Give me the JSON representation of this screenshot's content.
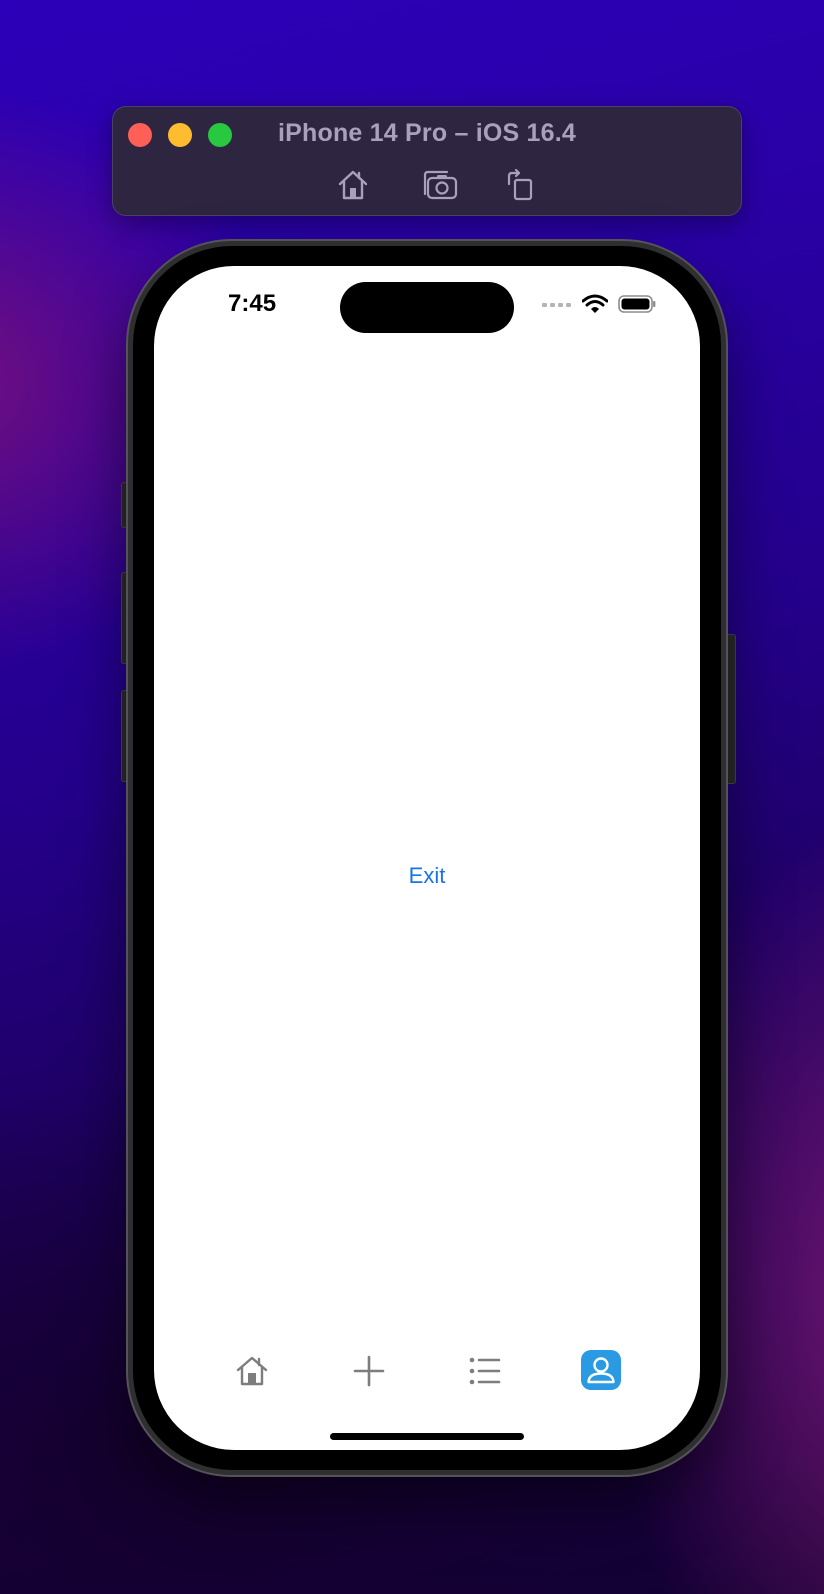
{
  "simulator": {
    "title": "iPhone 14 Pro – iOS 16.4",
    "window_controls": [
      "close",
      "minimize",
      "zoom"
    ],
    "toolbar": [
      {
        "name": "home-button",
        "icon": "home-icon"
      },
      {
        "name": "screenshot-button",
        "icon": "camera-icon"
      },
      {
        "name": "rotate-button",
        "icon": "rotate-icon"
      }
    ]
  },
  "status_bar": {
    "time": "7:45"
  },
  "main": {
    "exit_label": "Exit"
  },
  "tab_bar": {
    "tabs": [
      {
        "name": "home",
        "icon": "home-icon",
        "selected": false
      },
      {
        "name": "add",
        "icon": "plus-icon",
        "selected": false
      },
      {
        "name": "list",
        "icon": "list-icon",
        "selected": false
      },
      {
        "name": "profile",
        "icon": "person-icon",
        "selected": true
      }
    ]
  },
  "colors": {
    "accent": "#1a73e8",
    "selected_tab": "#2a9be2",
    "close": "#fe5f57",
    "minimize": "#febc2e",
    "zoom": "#28c840"
  }
}
